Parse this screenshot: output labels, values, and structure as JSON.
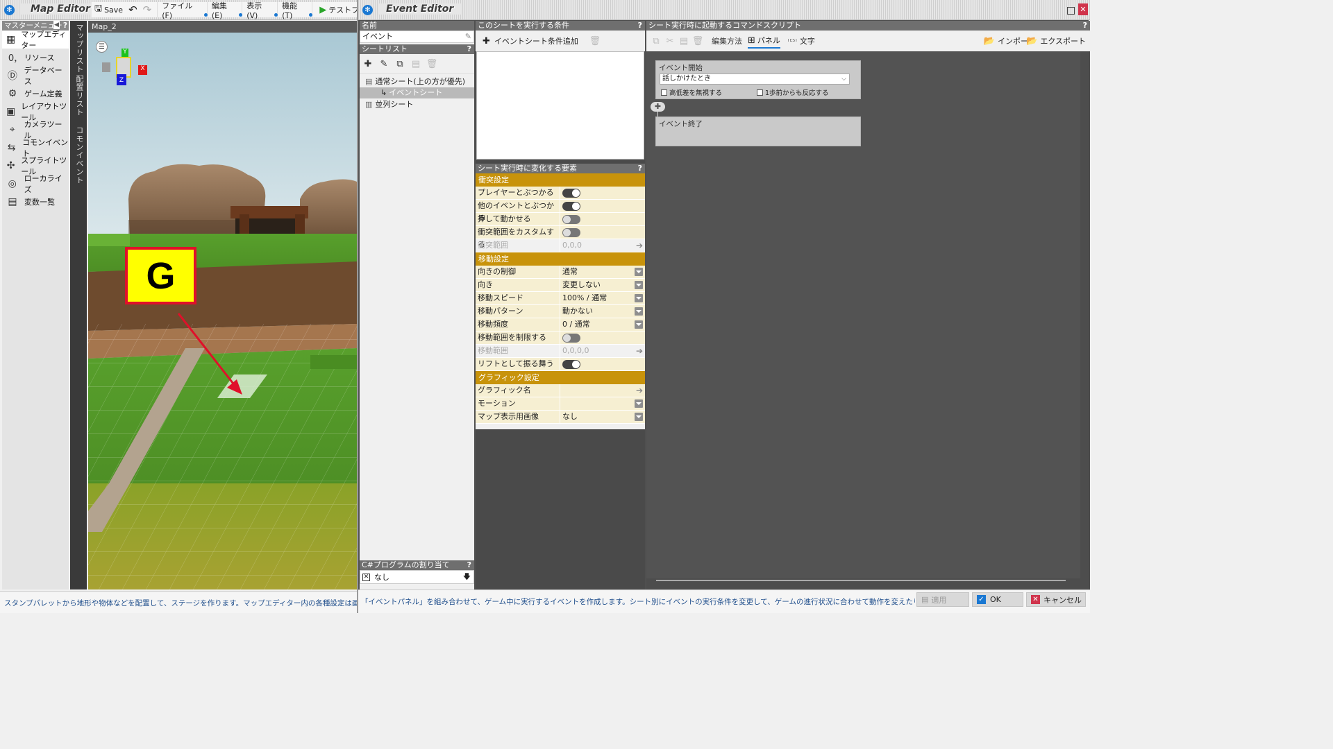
{
  "map_editor": {
    "title": "Map Editor",
    "save_label": "Save",
    "menus": [
      "ファイル(F)",
      "編集(E)",
      "表示(V)",
      "機能(T)"
    ],
    "test_play_label": "テストプレイ",
    "sidebar": {
      "title": "マスターメニュー",
      "items": [
        {
          "label": "マップエディター",
          "icon": "map-editor-icon",
          "active": true
        },
        {
          "label": "リソース",
          "icon": "resource-icon"
        },
        {
          "label": "データベース",
          "icon": "database-icon"
        },
        {
          "label": "ゲーム定義",
          "icon": "game-definition-icon"
        },
        {
          "label": "レイアウトツール",
          "icon": "layout-tool-icon"
        },
        {
          "label": "カメラツール",
          "icon": "camera-tool-icon"
        },
        {
          "label": "コモンイベント",
          "icon": "common-event-icon"
        },
        {
          "label": "スプライトツール",
          "icon": "sprite-tool-icon"
        },
        {
          "label": "ローカライズ",
          "icon": "localize-icon"
        },
        {
          "label": "変数一覧",
          "icon": "variable-list-icon"
        }
      ]
    },
    "vertical_tabs": [
      "マップリスト",
      "配置リスト",
      "コモンイベント"
    ],
    "map_tab": "Map_2",
    "gizmo": {
      "x": "X",
      "y": "Y",
      "z": "Z"
    },
    "marker_label": "G",
    "status": "スタンプパレットから地形や物体などを配置して、ステージを作ります。マップエディター内の各種設定は画面右下のボタンや、"
  },
  "event_editor": {
    "title": "Event Editor",
    "name_label": "名前",
    "name_value": "イベント",
    "sheet_list_label": "シートリスト",
    "sheets": {
      "normal": "通常シート(上の方が優先)",
      "event_sheet": "イベントシート",
      "parallel": "並列シート"
    },
    "csharp_label": "C#プログラムの割り当て",
    "csharp_value": "なし",
    "conditions_label": "このシートを実行する条件",
    "add_condition_label": "イベントシート条件追加",
    "props_label": "シート実行時に変化する要素",
    "sections": {
      "collision": "衝突設定",
      "movement": "移動設定",
      "graphic": "グラフィック設定"
    },
    "collision_rows": [
      {
        "key": "プレイヤーとぶつかる",
        "type": "toggle",
        "on": true
      },
      {
        "key": "他のイベントとぶつかる",
        "type": "toggle",
        "on": true
      },
      {
        "key": "押して動かせる",
        "type": "toggle",
        "on": false
      },
      {
        "key": "衝突範囲をカスタムする",
        "type": "toggle",
        "on": false
      },
      {
        "key": "衝突範囲",
        "type": "arrow",
        "value": "0,0,0",
        "disabled": true
      }
    ],
    "movement_rows": [
      {
        "key": "向きの制御",
        "type": "dropdown",
        "value": "通常"
      },
      {
        "key": "向き",
        "type": "dropdown",
        "value": "変更しない"
      },
      {
        "key": "移動スピード",
        "type": "dropdown",
        "value": "100% / 通常"
      },
      {
        "key": "移動パターン",
        "type": "dropdown",
        "value": "動かない"
      },
      {
        "key": "移動頻度",
        "type": "dropdown",
        "value": "0 / 通常"
      },
      {
        "key": "移動範囲を制限する",
        "type": "toggle",
        "on": false
      },
      {
        "key": "移動範囲",
        "type": "arrow",
        "value": "0,0,0,0",
        "disabled": true
      },
      {
        "key": "リフトとして振る舞う",
        "type": "toggle",
        "on": true
      }
    ],
    "graphic_rows": [
      {
        "key": "グラフィック名",
        "type": "arrow",
        "value": ""
      },
      {
        "key": "モーション",
        "type": "dropdown",
        "value": ""
      },
      {
        "key": "マップ表示用画像",
        "type": "dropdown",
        "value": "なし"
      }
    ],
    "script_label": "シート実行時に起動するコマンドスクリプト",
    "script_toolbar": {
      "edit_method": "編集方法",
      "panel": "パネル",
      "text": "文字",
      "test_badge": "TEST",
      "import": "インポート",
      "export": "エクスポート"
    },
    "event_start": {
      "label": "イベント開始",
      "trigger": "話しかけたとき",
      "opt1": "高低差を無視する",
      "opt2": "1歩前からも反応する"
    },
    "event_end": "イベント終了",
    "status": "「イベントパネル」を組み合わせて、ゲーム中に実行するイベントを作成します。シート別にイベントの実行条件を変更して、ゲームの進行状況に合わせて動作を変えたり、並列イベントを同時に実",
    "apply_label": "適用",
    "ok_label": "OK",
    "cancel_label": "キャンセル"
  },
  "colors": {
    "accent_blue": "#1a78d2",
    "section_gold": "#c8930b",
    "prop_bg": "#f6efd2",
    "panel_dark": "#4a4a4a",
    "marker_yellow": "#ffff00",
    "marker_red": "#e0102a"
  }
}
